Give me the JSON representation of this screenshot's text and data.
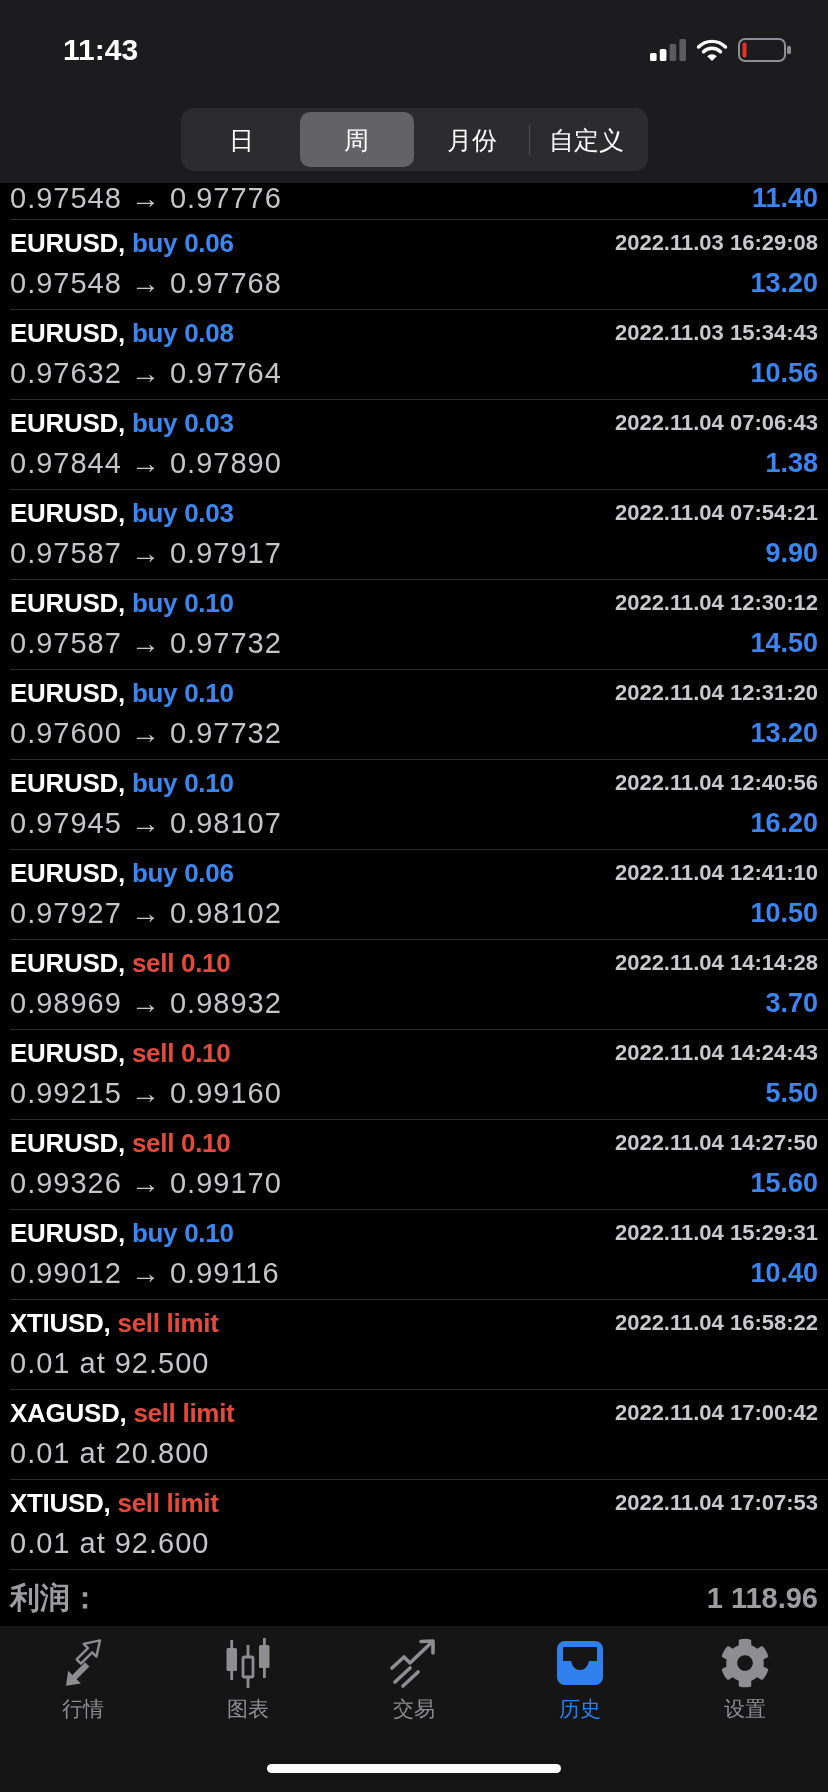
{
  "status_bar": {
    "time": "11:43"
  },
  "periods": [
    {
      "label": "日",
      "selected": false
    },
    {
      "label": "周",
      "selected": true
    },
    {
      "label": "月份",
      "selected": false
    },
    {
      "label": "自定义",
      "selected": false
    }
  ],
  "cut_off_row": {
    "prices": "0.97548 → 0.97776",
    "profit": "11.40"
  },
  "rows": [
    {
      "symbol": "EURUSD,",
      "action": "buy 0.06",
      "color": "#3b87f2",
      "time": "2022.11.03 16:29:08",
      "prices": "0.97548 → 0.97768",
      "profit": "13.20"
    },
    {
      "symbol": "EURUSD,",
      "action": "buy 0.08",
      "color": "#3b87f2",
      "time": "2022.11.03 15:34:43",
      "prices": "0.97632 → 0.97764",
      "profit": "10.56"
    },
    {
      "symbol": "EURUSD,",
      "action": "buy 0.03",
      "color": "#3b87f2",
      "time": "2022.11.04 07:06:43",
      "prices": "0.97844 → 0.97890",
      "profit": "1.38"
    },
    {
      "symbol": "EURUSD,",
      "action": "buy 0.03",
      "color": "#3b87f2",
      "time": "2022.11.04 07:54:21",
      "prices": "0.97587 → 0.97917",
      "profit": "9.90"
    },
    {
      "symbol": "EURUSD,",
      "action": "buy 0.10",
      "color": "#3b87f2",
      "time": "2022.11.04 12:30:12",
      "prices": "0.97587 → 0.97732",
      "profit": "14.50"
    },
    {
      "symbol": "EURUSD,",
      "action": "buy 0.10",
      "color": "#3b87f2",
      "time": "2022.11.04 12:31:20",
      "prices": "0.97600 → 0.97732",
      "profit": "13.20"
    },
    {
      "symbol": "EURUSD,",
      "action": "buy 0.10",
      "color": "#3b87f2",
      "time": "2022.11.04 12:40:56",
      "prices": "0.97945 → 0.98107",
      "profit": "16.20"
    },
    {
      "symbol": "EURUSD,",
      "action": "buy 0.06",
      "color": "#3b87f2",
      "time": "2022.11.04 12:41:10",
      "prices": "0.97927 → 0.98102",
      "profit": "10.50"
    },
    {
      "symbol": "EURUSD,",
      "action": "sell 0.10",
      "color": "#e5493c",
      "time": "2022.11.04 14:14:28",
      "prices": "0.98969 → 0.98932",
      "profit": "3.70"
    },
    {
      "symbol": "EURUSD,",
      "action": "sell 0.10",
      "color": "#e5493c",
      "time": "2022.11.04 14:24:43",
      "prices": "0.99215 → 0.99160",
      "profit": "5.50"
    },
    {
      "symbol": "EURUSD,",
      "action": "sell 0.10",
      "color": "#e5493c",
      "time": "2022.11.04 14:27:50",
      "prices": "0.99326 → 0.99170",
      "profit": "15.60"
    },
    {
      "symbol": "EURUSD,",
      "action": "buy 0.10",
      "color": "#3b87f2",
      "time": "2022.11.04 15:29:31",
      "prices": "0.99012 → 0.99116",
      "profit": "10.40"
    },
    {
      "symbol": "XTIUSD,",
      "action": "sell limit",
      "color": "#e5493c",
      "time": "2022.11.04 16:58:22",
      "prices": "0.01 at 92.500"
    },
    {
      "symbol": "XAGUSD,",
      "action": "sell limit",
      "color": "#e5493c",
      "time": "2022.11.04 17:00:42",
      "prices": "0.01 at 20.800"
    },
    {
      "symbol": "XTIUSD,",
      "action": "sell limit",
      "color": "#e5493c",
      "time": "2022.11.04 17:07:53",
      "prices": "0.01 at 92.600"
    }
  ],
  "total": {
    "label": "利润：",
    "value": "1 118.96"
  },
  "tabs": [
    {
      "label": "行情",
      "selected": false
    },
    {
      "label": "图表",
      "selected": false
    },
    {
      "label": "交易",
      "selected": false
    },
    {
      "label": "历史",
      "selected": true
    },
    {
      "label": "设置",
      "selected": false
    }
  ]
}
